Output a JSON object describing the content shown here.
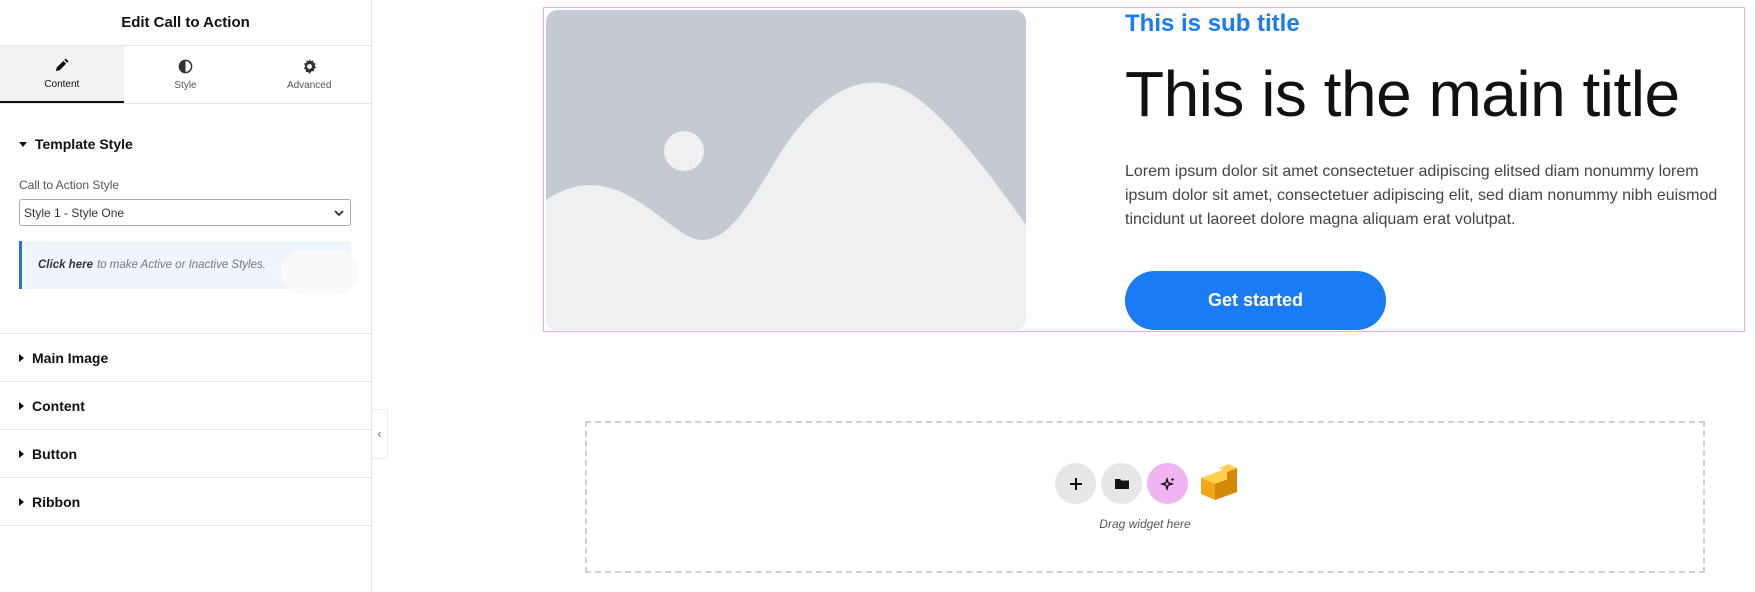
{
  "sidebar": {
    "title": "Edit Call to Action",
    "tabs": [
      {
        "label": "Content",
        "icon": "pencil-icon",
        "active": true
      },
      {
        "label": "Style",
        "icon": "half-circle-icon",
        "active": false
      },
      {
        "label": "Advanced",
        "icon": "gear-icon",
        "active": false
      }
    ],
    "template_section": {
      "title": "Template Style",
      "field_label": "Call to Action Style",
      "select_value": "Style 1 - Style One",
      "notice_link": "Click here",
      "notice_text": "to make Active or Inactive Styles."
    },
    "sections": [
      "Main Image",
      "Content",
      "Button",
      "Ribbon"
    ],
    "collapse_glyph": "‹"
  },
  "cta": {
    "subtitle": "This is sub title",
    "main_title": "This is the main title",
    "description": "Lorem ipsum dolor sit amet consectetuer adipiscing elitsed diam nonummy lorem ipsum dolor sit amet, consectetuer adipiscing elit, sed diam nonummy nibh euismod tincidunt ut laoreet dolore magna aliquam erat volutpat.",
    "button_label": "Get started",
    "accent_color": "#1a7cf5"
  },
  "drop_zone": {
    "label": "Drag widget here",
    "actions": [
      "plus-icon",
      "folder-icon",
      "sparkle-icon",
      "cube-icon"
    ]
  }
}
